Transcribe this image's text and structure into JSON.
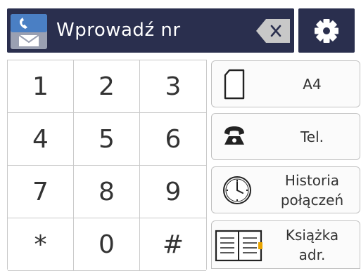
{
  "number_field": {
    "placeholder": "Wprowadź nr"
  },
  "keypad": {
    "keys": [
      "1",
      "2",
      "3",
      "4",
      "5",
      "6",
      "7",
      "8",
      "9",
      "*",
      "0",
      "#"
    ]
  },
  "side_buttons": {
    "paper": {
      "label": "A4"
    },
    "tel": {
      "label": "Tel."
    },
    "history": {
      "label": "Historia\npołączeń"
    },
    "address_book": {
      "label": "Książka\nadr."
    }
  },
  "icons": {
    "fax": "fax-envelope-icon",
    "backspace": "backspace-icon",
    "settings": "gear-icon",
    "paper": "paper-sheet-icon",
    "tel": "telephone-icon",
    "history": "clock-icon",
    "address_book": "address-book-icon"
  },
  "colors": {
    "header_bg": "#2a2f4e",
    "fax_icon_top": "#4a7fc4",
    "fax_icon_bottom": "#9aa0b2",
    "key_text": "#333333"
  }
}
